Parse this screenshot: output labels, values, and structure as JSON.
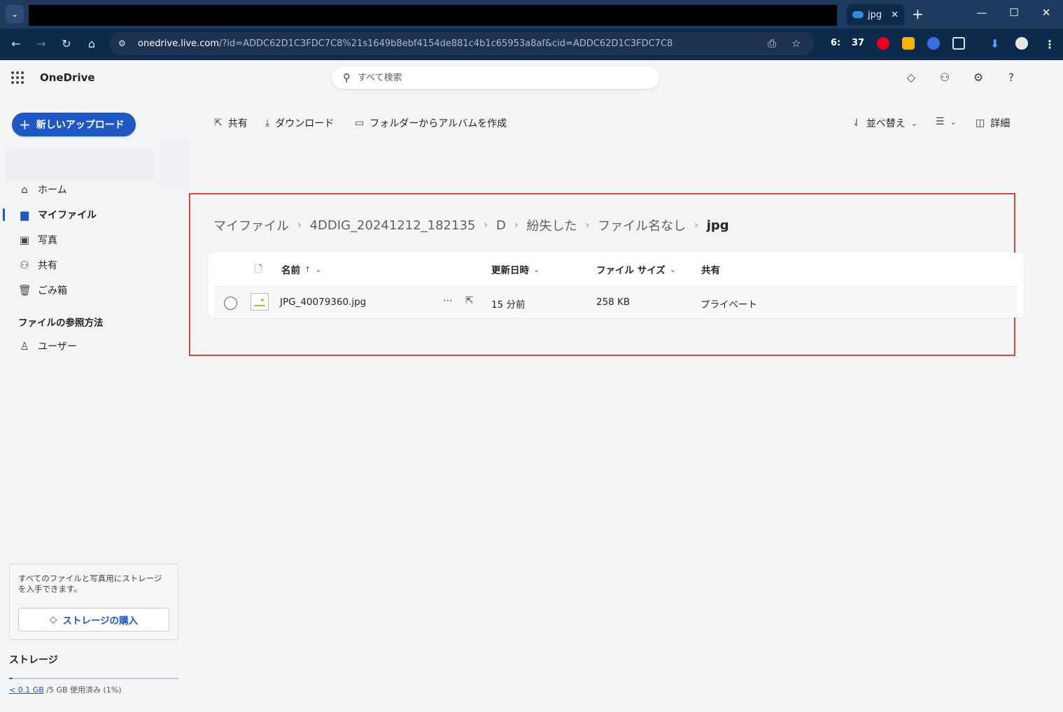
{
  "browser": {
    "tab_title": "jpg",
    "tab_close": "✕",
    "new_tab": "+",
    "url_host": "onedrive.live.com",
    "url_rest": "/?id=ADDC62D1C3FDC7C8%21s1649b8ebf4154de881c4b1c65953a8af&cid=ADDC62D1C3FDC7C8",
    "ext_time_h": "6:",
    "ext_time_m": "37",
    "minimize": "—",
    "maximize": "☐",
    "close": "✕"
  },
  "app": {
    "brand": "OneDrive",
    "search_placeholder": "すべて検索"
  },
  "sidebar": {
    "new_button": "新しいアップロード",
    "items": [
      {
        "label": "ホーム",
        "icon": "home-icon"
      },
      {
        "label": "マイファイル",
        "icon": "folder-icon"
      },
      {
        "label": "写真",
        "icon": "photo-icon"
      },
      {
        "label": "共有",
        "icon": "people-icon"
      },
      {
        "label": "ごみ箱",
        "icon": "trash-icon"
      }
    ],
    "browse_heading": "ファイルの参照方法",
    "browse_items": [
      {
        "label": "ユーザー",
        "icon": "person-icon"
      }
    ],
    "storage_promo": "すべてのファイルと写真用にストレージを入手できます。",
    "buy_storage": "ストレージの購入",
    "storage_title": "ストレージ",
    "storage_used": "< 0.1 GB",
    "storage_total": "/5 GB 使用済み (1%)",
    "storage_fraction": 0.01
  },
  "commands": {
    "share": "共有",
    "download": "ダウンロード",
    "album": "フォルダーからアルバムを作成",
    "sort": "並べ替え",
    "details": "詳細"
  },
  "breadcrumb": [
    "マイファイル",
    "4DDIG_20241212_182135",
    "D",
    "紛失した",
    "ファイル名なし",
    "jpg"
  ],
  "table": {
    "columns": {
      "name": "名前",
      "name_sort": "↑",
      "modified": "更新日時",
      "size": "ファイル サイズ",
      "sharing": "共有"
    },
    "rows": [
      {
        "name": "JPG_40079360.jpg",
        "modified": "15 分前",
        "size": "258 KB",
        "sharing": "プライベート"
      }
    ]
  },
  "colors": {
    "accent": "#1f57c3",
    "highlight_border": "#d9453c",
    "browser_bg": "#0d2a4d"
  }
}
